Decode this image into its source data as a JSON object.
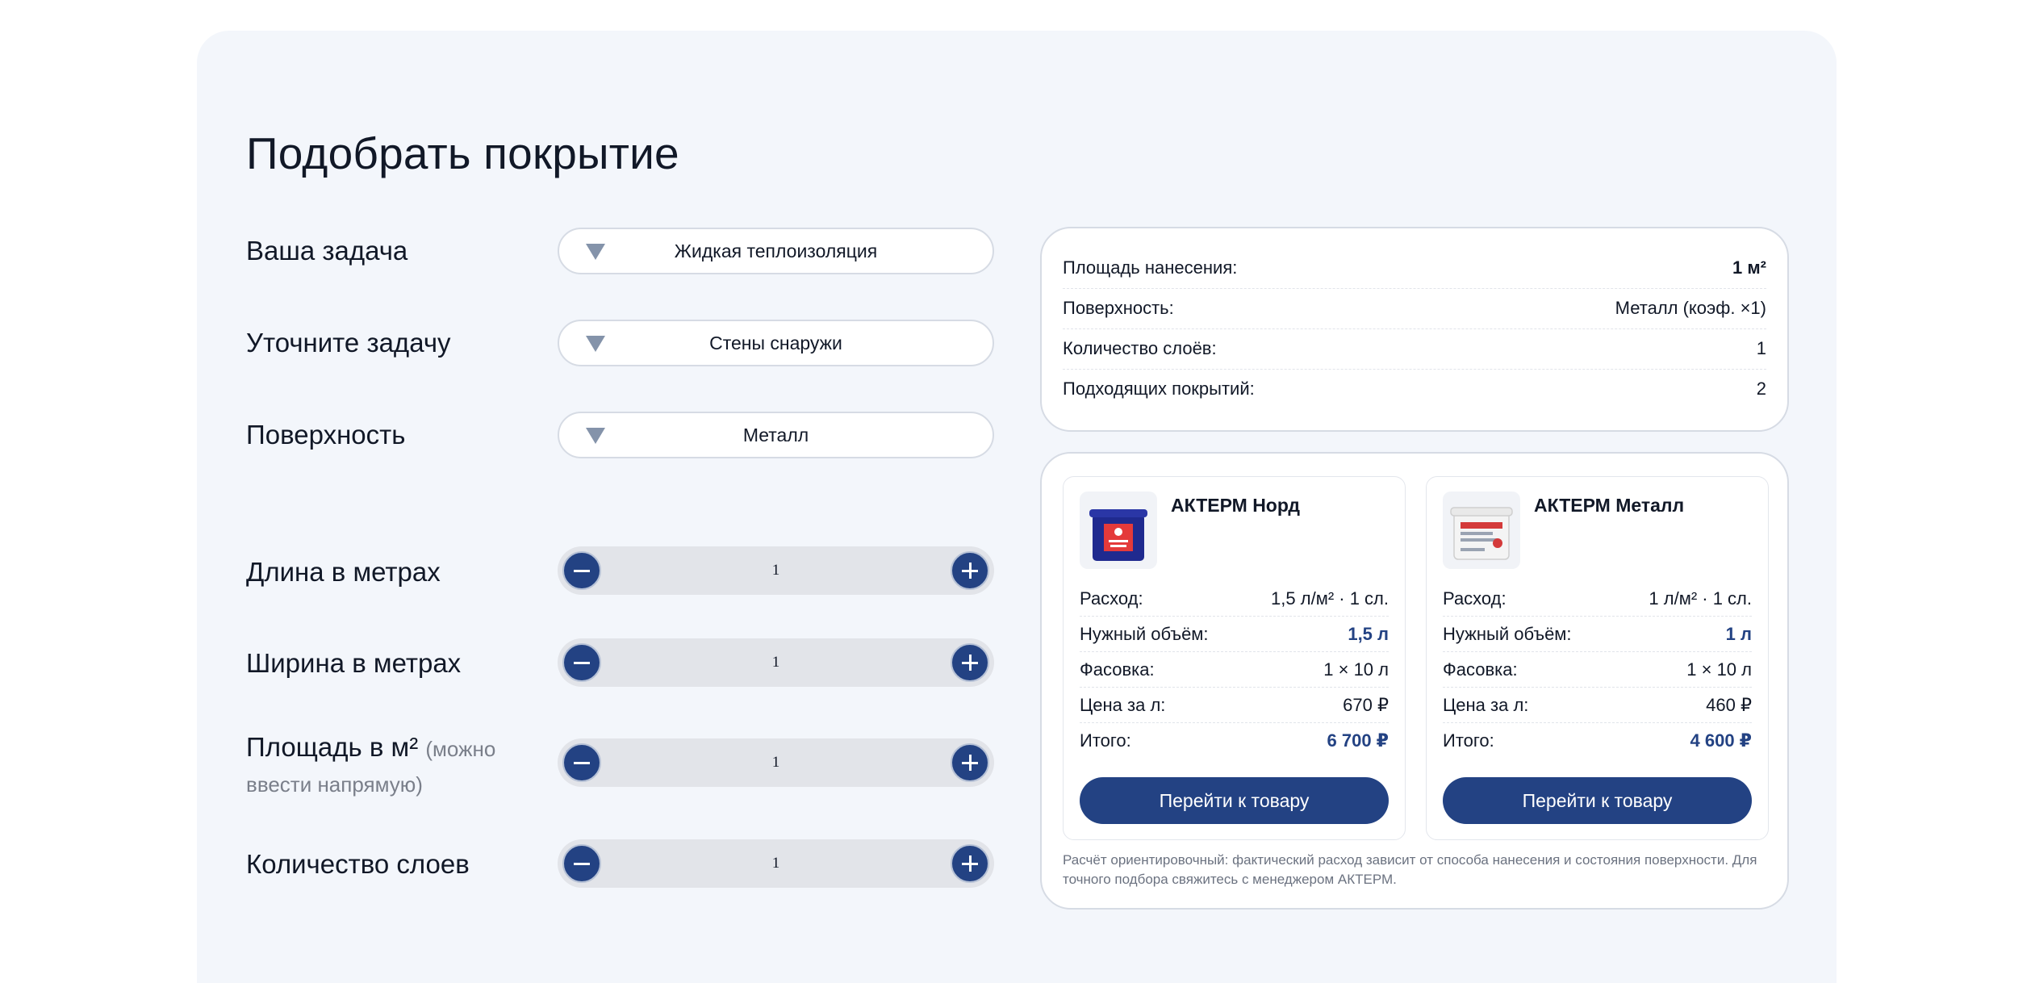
{
  "title": "Подобрать покрытие",
  "selects": [
    {
      "label": "Ваша задача",
      "value": "Жидкая теплоизоляция"
    },
    {
      "label": "Уточните задачу",
      "value": "Стены снаружи"
    },
    {
      "label": "Поверхность",
      "value": "Металл"
    }
  ],
  "steppers": [
    {
      "label": "Длина в метрах",
      "value": "1"
    },
    {
      "label": "Ширина в метрах",
      "value": "1"
    },
    {
      "label": "Площадь в м²",
      "hint": "(можно ввести напрямую)",
      "value": "1"
    },
    {
      "label": "Количество слоев",
      "value": "1"
    }
  ],
  "summary": [
    {
      "key": "Площадь нанесения:",
      "value": "1 м²"
    },
    {
      "key": "Поверхность:",
      "value": "Металл (коэф. ×1)"
    },
    {
      "key": "Количество слоёв:",
      "value": "1"
    },
    {
      "key": "Подходящих покрытий:",
      "value": "2"
    }
  ],
  "products": [
    {
      "name": "АКТЕРМ Норд",
      "rows": [
        {
          "key": "Расход:",
          "value": "1,5 л/м² · 1 сл."
        },
        {
          "key": "Нужный объём:",
          "value": "1,5 л"
        },
        {
          "key": "Фасовка:",
          "value": "1 × 10 л"
        },
        {
          "key": "Цена за л:",
          "value": "670 ₽"
        },
        {
          "key": "Итого:",
          "value": "6 700 ₽"
        }
      ],
      "button": "Перейти к товару"
    },
    {
      "name": "АКТЕРМ Металл",
      "rows": [
        {
          "key": "Расход:",
          "value": "1 л/м² · 1 сл."
        },
        {
          "key": "Нужный объём:",
          "value": "1 л"
        },
        {
          "key": "Фасовка:",
          "value": "1 × 10 л"
        },
        {
          "key": "Цена за л:",
          "value": "460 ₽"
        },
        {
          "key": "Итого:",
          "value": "4 600 ₽"
        }
      ],
      "button": "Перейти к товару"
    }
  ],
  "note": "Расчёт ориентировочный: фактический расход зависит от способа нанесения и состояния поверхности. Для точного подбора свяжитесь с менеджером АКТЕРМ.",
  "colors": {
    "accent": "#234283",
    "panel": "#f3f6fb"
  },
  "icons": {
    "select_arrow": "triangle-down-icon",
    "decrement": "minus-icon",
    "increment": "plus-icon"
  }
}
